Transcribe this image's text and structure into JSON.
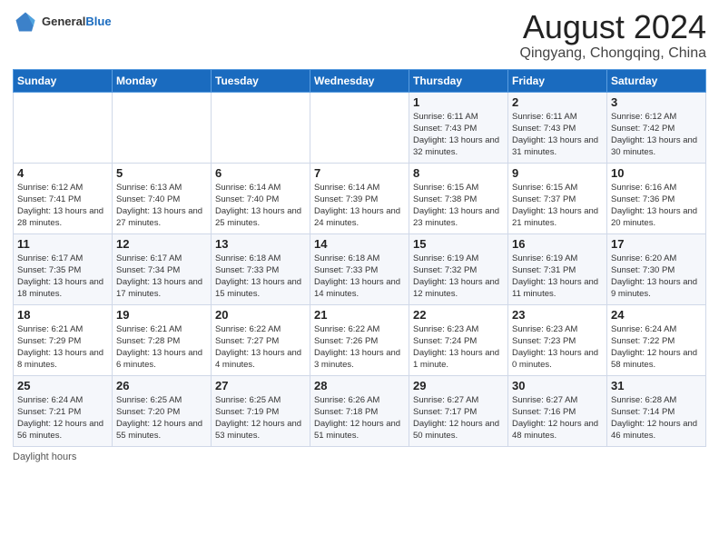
{
  "header": {
    "logo_general": "General",
    "logo_blue": "Blue",
    "month_title": "August 2024",
    "subtitle": "Qingyang, Chongqing, China"
  },
  "weekdays": [
    "Sunday",
    "Monday",
    "Tuesday",
    "Wednesday",
    "Thursday",
    "Friday",
    "Saturday"
  ],
  "weeks": [
    [
      {
        "day": "",
        "sunrise": "",
        "sunset": "",
        "daylight": ""
      },
      {
        "day": "",
        "sunrise": "",
        "sunset": "",
        "daylight": ""
      },
      {
        "day": "",
        "sunrise": "",
        "sunset": "",
        "daylight": ""
      },
      {
        "day": "",
        "sunrise": "",
        "sunset": "",
        "daylight": ""
      },
      {
        "day": "1",
        "sunrise": "Sunrise: 6:11 AM",
        "sunset": "Sunset: 7:43 PM",
        "daylight": "Daylight: 13 hours and 32 minutes."
      },
      {
        "day": "2",
        "sunrise": "Sunrise: 6:11 AM",
        "sunset": "Sunset: 7:43 PM",
        "daylight": "Daylight: 13 hours and 31 minutes."
      },
      {
        "day": "3",
        "sunrise": "Sunrise: 6:12 AM",
        "sunset": "Sunset: 7:42 PM",
        "daylight": "Daylight: 13 hours and 30 minutes."
      }
    ],
    [
      {
        "day": "4",
        "sunrise": "Sunrise: 6:12 AM",
        "sunset": "Sunset: 7:41 PM",
        "daylight": "Daylight: 13 hours and 28 minutes."
      },
      {
        "day": "5",
        "sunrise": "Sunrise: 6:13 AM",
        "sunset": "Sunset: 7:40 PM",
        "daylight": "Daylight: 13 hours and 27 minutes."
      },
      {
        "day": "6",
        "sunrise": "Sunrise: 6:14 AM",
        "sunset": "Sunset: 7:40 PM",
        "daylight": "Daylight: 13 hours and 25 minutes."
      },
      {
        "day": "7",
        "sunrise": "Sunrise: 6:14 AM",
        "sunset": "Sunset: 7:39 PM",
        "daylight": "Daylight: 13 hours and 24 minutes."
      },
      {
        "day": "8",
        "sunrise": "Sunrise: 6:15 AM",
        "sunset": "Sunset: 7:38 PM",
        "daylight": "Daylight: 13 hours and 23 minutes."
      },
      {
        "day": "9",
        "sunrise": "Sunrise: 6:15 AM",
        "sunset": "Sunset: 7:37 PM",
        "daylight": "Daylight: 13 hours and 21 minutes."
      },
      {
        "day": "10",
        "sunrise": "Sunrise: 6:16 AM",
        "sunset": "Sunset: 7:36 PM",
        "daylight": "Daylight: 13 hours and 20 minutes."
      }
    ],
    [
      {
        "day": "11",
        "sunrise": "Sunrise: 6:17 AM",
        "sunset": "Sunset: 7:35 PM",
        "daylight": "Daylight: 13 hours and 18 minutes."
      },
      {
        "day": "12",
        "sunrise": "Sunrise: 6:17 AM",
        "sunset": "Sunset: 7:34 PM",
        "daylight": "Daylight: 13 hours and 17 minutes."
      },
      {
        "day": "13",
        "sunrise": "Sunrise: 6:18 AM",
        "sunset": "Sunset: 7:33 PM",
        "daylight": "Daylight: 13 hours and 15 minutes."
      },
      {
        "day": "14",
        "sunrise": "Sunrise: 6:18 AM",
        "sunset": "Sunset: 7:33 PM",
        "daylight": "Daylight: 13 hours and 14 minutes."
      },
      {
        "day": "15",
        "sunrise": "Sunrise: 6:19 AM",
        "sunset": "Sunset: 7:32 PM",
        "daylight": "Daylight: 13 hours and 12 minutes."
      },
      {
        "day": "16",
        "sunrise": "Sunrise: 6:19 AM",
        "sunset": "Sunset: 7:31 PM",
        "daylight": "Daylight: 13 hours and 11 minutes."
      },
      {
        "day": "17",
        "sunrise": "Sunrise: 6:20 AM",
        "sunset": "Sunset: 7:30 PM",
        "daylight": "Daylight: 13 hours and 9 minutes."
      }
    ],
    [
      {
        "day": "18",
        "sunrise": "Sunrise: 6:21 AM",
        "sunset": "Sunset: 7:29 PM",
        "daylight": "Daylight: 13 hours and 8 minutes."
      },
      {
        "day": "19",
        "sunrise": "Sunrise: 6:21 AM",
        "sunset": "Sunset: 7:28 PM",
        "daylight": "Daylight: 13 hours and 6 minutes."
      },
      {
        "day": "20",
        "sunrise": "Sunrise: 6:22 AM",
        "sunset": "Sunset: 7:27 PM",
        "daylight": "Daylight: 13 hours and 4 minutes."
      },
      {
        "day": "21",
        "sunrise": "Sunrise: 6:22 AM",
        "sunset": "Sunset: 7:26 PM",
        "daylight": "Daylight: 13 hours and 3 minutes."
      },
      {
        "day": "22",
        "sunrise": "Sunrise: 6:23 AM",
        "sunset": "Sunset: 7:24 PM",
        "daylight": "Daylight: 13 hours and 1 minute."
      },
      {
        "day": "23",
        "sunrise": "Sunrise: 6:23 AM",
        "sunset": "Sunset: 7:23 PM",
        "daylight": "Daylight: 13 hours and 0 minutes."
      },
      {
        "day": "24",
        "sunrise": "Sunrise: 6:24 AM",
        "sunset": "Sunset: 7:22 PM",
        "daylight": "Daylight: 12 hours and 58 minutes."
      }
    ],
    [
      {
        "day": "25",
        "sunrise": "Sunrise: 6:24 AM",
        "sunset": "Sunset: 7:21 PM",
        "daylight": "Daylight: 12 hours and 56 minutes."
      },
      {
        "day": "26",
        "sunrise": "Sunrise: 6:25 AM",
        "sunset": "Sunset: 7:20 PM",
        "daylight": "Daylight: 12 hours and 55 minutes."
      },
      {
        "day": "27",
        "sunrise": "Sunrise: 6:25 AM",
        "sunset": "Sunset: 7:19 PM",
        "daylight": "Daylight: 12 hours and 53 minutes."
      },
      {
        "day": "28",
        "sunrise": "Sunrise: 6:26 AM",
        "sunset": "Sunset: 7:18 PM",
        "daylight": "Daylight: 12 hours and 51 minutes."
      },
      {
        "day": "29",
        "sunrise": "Sunrise: 6:27 AM",
        "sunset": "Sunset: 7:17 PM",
        "daylight": "Daylight: 12 hours and 50 minutes."
      },
      {
        "day": "30",
        "sunrise": "Sunrise: 6:27 AM",
        "sunset": "Sunset: 7:16 PM",
        "daylight": "Daylight: 12 hours and 48 minutes."
      },
      {
        "day": "31",
        "sunrise": "Sunrise: 6:28 AM",
        "sunset": "Sunset: 7:14 PM",
        "daylight": "Daylight: 12 hours and 46 minutes."
      }
    ]
  ],
  "footer": {
    "daylight_label": "Daylight hours"
  }
}
